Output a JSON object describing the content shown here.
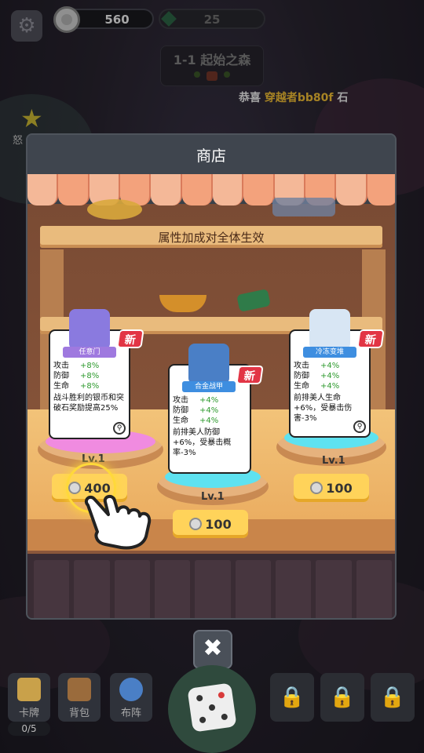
{
  "hud": {
    "silver_coins": "560",
    "gems": "25",
    "stage_title": "1-1 起始之森",
    "congrats_prefix": "恭喜",
    "congrats_name": "穿越者bb80f",
    "congrats_suffix": "石",
    "anger_label": "怒"
  },
  "shop": {
    "title": "商店",
    "banner": "属性加成对全体生效",
    "new_badge": "新",
    "items": [
      {
        "name": "任意门",
        "stats": [
          {
            "label": "攻击",
            "value": "+8%"
          },
          {
            "label": "防御",
            "value": "+8%"
          },
          {
            "label": "生命",
            "value": "+8%"
          }
        ],
        "desc": "战斗胜利的银币和突破石奖励提高25%",
        "level": "Lv.1",
        "price": "400"
      },
      {
        "name": "合金战甲",
        "stats": [
          {
            "label": "攻击",
            "value": "+4%"
          },
          {
            "label": "防御",
            "value": "+4%"
          },
          {
            "label": "生命",
            "value": "+4%"
          }
        ],
        "desc": "前排美人防御+6%，受暴击概率-3%",
        "level": "Lv.1",
        "price": "100"
      },
      {
        "name": "冷冻变堆",
        "stats": [
          {
            "label": "攻击",
            "value": "+4%"
          },
          {
            "label": "防御",
            "value": "+4%"
          },
          {
            "label": "生命",
            "value": "+4%"
          }
        ],
        "desc": "前排美人生命+6%，受暴击伤害-3%",
        "level": "Lv.1",
        "price": "100"
      }
    ]
  },
  "bottom": {
    "cards_label": "卡牌",
    "bag_label": "背包",
    "formation_label": "布阵",
    "count": "0/5"
  },
  "colors": {
    "accent_gold": "#ffd35a",
    "new_red": "#e23545",
    "stat_green": "#2e9a2e"
  }
}
